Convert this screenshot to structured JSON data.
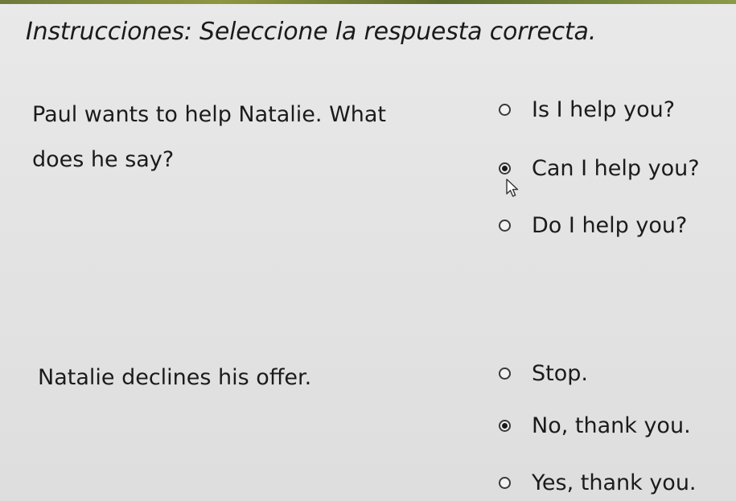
{
  "instructions": "Instrucciones: Seleccione la respuesta correcta.",
  "questions": [
    {
      "text_line1": "Paul wants to help Natalie. What",
      "text_line2": "does he say?",
      "options": [
        {
          "label": "Is I help you?",
          "selected": false
        },
        {
          "label": "Can I help you?",
          "selected": true
        },
        {
          "label": "Do I help you?",
          "selected": false
        }
      ]
    },
    {
      "text_line1": "Natalie declines his offer.",
      "options": [
        {
          "label": "Stop.",
          "selected": false
        },
        {
          "label": "No, thank you.",
          "selected": true
        },
        {
          "label": "Yes, thank you.",
          "selected": false
        }
      ]
    }
  ]
}
